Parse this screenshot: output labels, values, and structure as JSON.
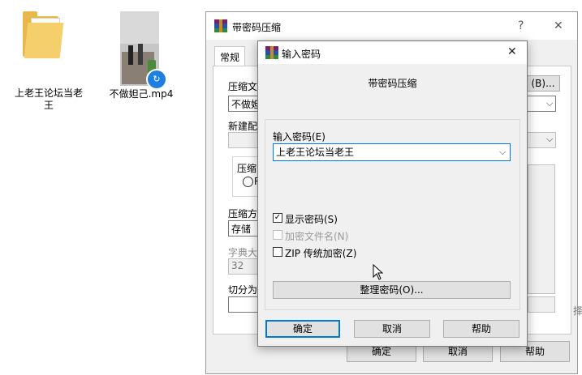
{
  "desktop": {
    "folder": {
      "label": "上老王论坛当老王",
      "icon": "folder-icon"
    },
    "video": {
      "label": "不做妲己.mp4",
      "icon": "video-file-icon",
      "badge_icon": "player-badge-icon"
    }
  },
  "back_dialog": {
    "title": "带密码压缩",
    "help_glyph": "?",
    "close_glyph": "✕",
    "tab_general": "常规",
    "archive_name_label": "压缩文",
    "browse_button": "(B)...",
    "archive_name_value": "不做妲",
    "new_profile_label": "新建配",
    "format_label": "压缩",
    "format_radio_letter": "R",
    "method_label": "压缩方",
    "method_value": "存储",
    "dict_label": "字典大",
    "dict_value": "32",
    "split_label": "切分为",
    "right_edge_fragment": "择",
    "ok_button": "确定",
    "cancel_button": "取消",
    "help_button": "帮助"
  },
  "front_dialog": {
    "title": "输入密码",
    "close_glyph": "✕",
    "heading": "带密码压缩",
    "password_label": "输入密码(E)",
    "password_value": "上老王论坛当老王",
    "show_password_label": "显示密码(S)",
    "show_password_checked": true,
    "encrypt_names_label": "加密文件名(N)",
    "encrypt_names_checked": false,
    "encrypt_names_enabled": false,
    "zip_legacy_label": "ZIP 传统加密(Z)",
    "zip_legacy_checked": false,
    "organize_button": "整理密码(O)...",
    "ok_button": "确定",
    "cancel_button": "取消",
    "help_button": "帮助"
  },
  "colors": {
    "accent": "#0078d7",
    "dialog_bg": "#f0f0f0",
    "title_bg": "#ffffff",
    "folder_yellow": "#f5cf6b"
  }
}
